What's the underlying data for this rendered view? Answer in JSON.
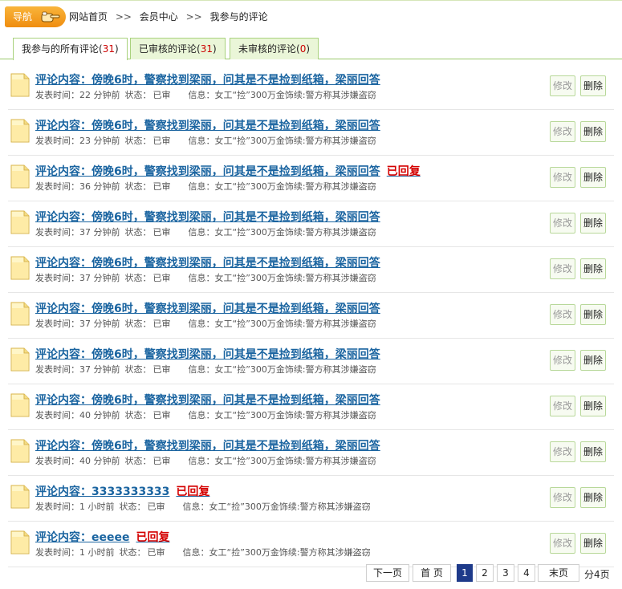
{
  "nav": {
    "label": "导航",
    "breadcrumb": [
      "网站首页",
      ">>",
      "会员中心",
      ">>",
      "我参与的评论"
    ]
  },
  "tabs": [
    {
      "label": "我参与的所有评论",
      "count": "31"
    },
    {
      "label": "已审核的评论",
      "count": "31"
    },
    {
      "label": "未审核的评论",
      "count": "0"
    }
  ],
  "labels": {
    "time_prefix": "发表时间：",
    "status_prefix": "状态：",
    "info_prefix": "信息：",
    "edit": "修改",
    "delete": "删除"
  },
  "comments": [
    {
      "title": "评论内容：傍晚6时，警察找到梁丽，问其是不是捡到纸箱，梁丽回答",
      "reply": "",
      "time": "22 分钟前",
      "status": "已审",
      "info": "女工“捡”300万金饰续:警方称其涉嫌盗窃"
    },
    {
      "title": "评论内容：傍晚6时，警察找到梁丽，问其是不是捡到纸箱，梁丽回答",
      "reply": "",
      "time": "23 分钟前",
      "status": "已审",
      "info": "女工“捡”300万金饰续:警方称其涉嫌盗窃"
    },
    {
      "title": "评论内容：傍晚6时，警察找到梁丽，问其是不是捡到纸箱，梁丽回答",
      "reply": "已回复",
      "time": "36 分钟前",
      "status": "已审",
      "info": "女工“捡”300万金饰续:警方称其涉嫌盗窃"
    },
    {
      "title": "评论内容：傍晚6时，警察找到梁丽，问其是不是捡到纸箱，梁丽回答",
      "reply": "",
      "time": "37 分钟前",
      "status": "已审",
      "info": "女工“捡”300万金饰续:警方称其涉嫌盗窃"
    },
    {
      "title": "评论内容：傍晚6时，警察找到梁丽，问其是不是捡到纸箱，梁丽回答",
      "reply": "",
      "time": "37 分钟前",
      "status": "已审",
      "info": "女工“捡”300万金饰续:警方称其涉嫌盗窃"
    },
    {
      "title": "评论内容：傍晚6时，警察找到梁丽，问其是不是捡到纸箱，梁丽回答",
      "reply": "",
      "time": "37 分钟前",
      "status": "已审",
      "info": "女工“捡”300万金饰续:警方称其涉嫌盗窃"
    },
    {
      "title": "评论内容：傍晚6时，警察找到梁丽，问其是不是捡到纸箱，梁丽回答",
      "reply": "",
      "time": "37 分钟前",
      "status": "已审",
      "info": "女工“捡”300万金饰续:警方称其涉嫌盗窃"
    },
    {
      "title": "评论内容：傍晚6时，警察找到梁丽，问其是不是捡到纸箱，梁丽回答",
      "reply": "",
      "time": "40 分钟前",
      "status": "已审",
      "info": "女工“捡”300万金饰续:警方称其涉嫌盗窃"
    },
    {
      "title": "评论内容：傍晚6时，警察找到梁丽，问其是不是捡到纸箱，梁丽回答",
      "reply": "",
      "time": "40 分钟前",
      "status": "已审",
      "info": "女工“捡”300万金饰续:警方称其涉嫌盗窃"
    },
    {
      "title": "评论内容：3333333333",
      "reply": "已回复",
      "time": "1 小时前",
      "status": "已审",
      "info": "女工“捡”300万金饰续:警方称其涉嫌盗窃"
    },
    {
      "title": "评论内容：eeeee",
      "reply": "已回复",
      "time": "1 小时前",
      "status": "已审",
      "info": "女工“捡”300万金饰续:警方称其涉嫌盗窃"
    }
  ],
  "pager": {
    "next": "下一页",
    "first": "首 页",
    "pages": [
      "1",
      "2",
      "3",
      "4"
    ],
    "current": "1",
    "last": "末页",
    "total": "分4页"
  }
}
